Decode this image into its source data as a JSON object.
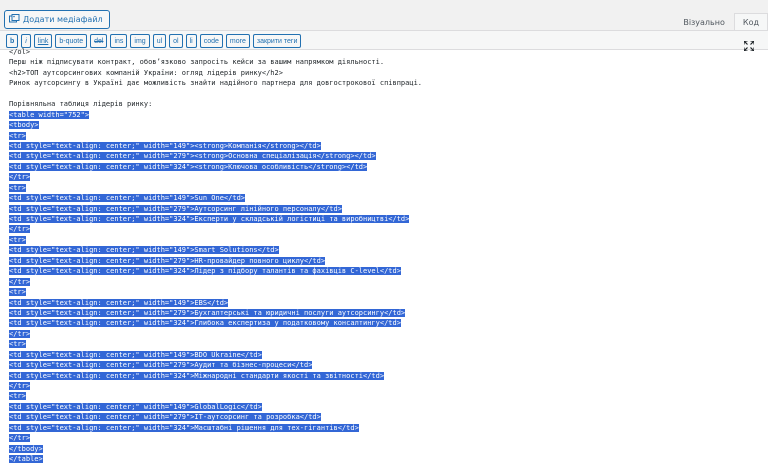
{
  "media": {
    "label": "Додати медіафайл"
  },
  "tabs": [
    {
      "label": "Візуально",
      "active": false
    },
    {
      "label": "Код",
      "active": true
    }
  ],
  "quicktags": [
    "b",
    "i",
    "link",
    "b-quote",
    "del",
    "ins",
    "img",
    "ul",
    "ol",
    "li",
    "code",
    "more",
    "закрити теги"
  ],
  "lines": [
    {
      "text": "</ol>",
      "selected": false
    },
    {
      "text": "Перш ніж підписувати контракт, обов’язково запросіть кейси за вашим напрямком діяльності.",
      "selected": false
    },
    {
      "text": "<h2>ТОП аутсорсингових компаній України: огляд лідерів ринку</h2>",
      "selected": false
    },
    {
      "text": "Ринок аутсорсингу в Україні дає можливість знайти надійного партнера для довгострокової співпраці.",
      "selected": false
    },
    {
      "text": "",
      "selected": false
    },
    {
      "text": "Порівняльна таблиця лідерів ринку:",
      "selected": false
    },
    {
      "text": "<table width=\"752\">",
      "selected": true
    },
    {
      "text": "<tbody>",
      "selected": true
    },
    {
      "text": "<tr>",
      "selected": true
    },
    {
      "text": "<td style=\"text-align: center;\" width=\"149\"><strong>Компанія</strong></td>",
      "selected": true
    },
    {
      "text": "<td style=\"text-align: center;\" width=\"279\"><strong>Основна спеціалізація</strong></td>",
      "selected": true
    },
    {
      "text": "<td style=\"text-align: center;\" width=\"324\"><strong>Ключова особливість</strong></td>",
      "selected": true
    },
    {
      "text": "</tr>",
      "selected": true
    },
    {
      "text": "<tr>",
      "selected": true
    },
    {
      "text": "<td style=\"text-align: center;\" width=\"149\">Sun One</td>",
      "selected": true
    },
    {
      "text": "<td style=\"text-align: center;\" width=\"279\">Аутсорсинг лінійного персоналу</td>",
      "selected": true
    },
    {
      "text": "<td style=\"text-align: center;\" width=\"324\">Експерти у складській логістиці та виробництві</td>",
      "selected": true
    },
    {
      "text": "</tr>",
      "selected": true
    },
    {
      "text": "<tr>",
      "selected": true
    },
    {
      "text": "<td style=\"text-align: center;\" width=\"149\">Smart Solutions</td>",
      "selected": true
    },
    {
      "text": "<td style=\"text-align: center;\" width=\"279\">HR-провайдер повного циклу</td>",
      "selected": true
    },
    {
      "text": "<td style=\"text-align: center;\" width=\"324\">Лідер з підбору талантів та фахівців C-level</td>",
      "selected": true
    },
    {
      "text": "</tr>",
      "selected": true
    },
    {
      "text": "<tr>",
      "selected": true
    },
    {
      "text": "<td style=\"text-align: center;\" width=\"149\">EBS</td>",
      "selected": true
    },
    {
      "text": "<td style=\"text-align: center;\" width=\"279\">Бухгалтерські та юридичні послуги аутсорсингу</td>",
      "selected": true
    },
    {
      "text": "<td style=\"text-align: center;\" width=\"324\">Глибока експертиза у податковому консалтингу</td>",
      "selected": true
    },
    {
      "text": "</tr>",
      "selected": true
    },
    {
      "text": "<tr>",
      "selected": true
    },
    {
      "text": "<td style=\"text-align: center;\" width=\"149\">BDO Ukraine</td>",
      "selected": true
    },
    {
      "text": "<td style=\"text-align: center;\" width=\"279\">Аудит та бізнес-процеси</td>",
      "selected": true
    },
    {
      "text": "<td style=\"text-align: center;\" width=\"324\">Міжнародні стандарти якості та звітності</td>",
      "selected": true
    },
    {
      "text": "</tr>",
      "selected": true
    },
    {
      "text": "<tr>",
      "selected": true
    },
    {
      "text": "<td style=\"text-align: center;\" width=\"149\">GlobalLogic</td>",
      "selected": true
    },
    {
      "text": "<td style=\"text-align: center;\" width=\"279\">IT-аутсорсинг та розробка</td>",
      "selected": true
    },
    {
      "text": "<td style=\"text-align: center;\" width=\"324\">Масштабні рішення для тех-гігантів</td>",
      "selected": true
    },
    {
      "text": "</tr>",
      "selected": true
    },
    {
      "text": "</tbody>",
      "selected": true
    },
    {
      "text": "</table>",
      "selected": true
    }
  ]
}
